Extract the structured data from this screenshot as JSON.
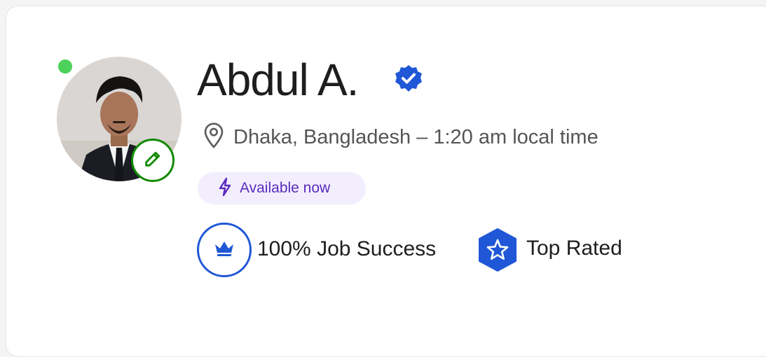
{
  "profile": {
    "name": "Abdul A.",
    "location": "Dhaka, Bangladesh – 1:20 am local time",
    "availability": "Available now",
    "online": true,
    "verified": true
  },
  "badges": {
    "job_success": "100% Job Success",
    "top_rated": "Top Rated"
  },
  "icons": {
    "verified": "verified-badge-icon",
    "location": "location-pin-icon",
    "availability": "lightning-bolt-icon",
    "edit": "pencil-icon",
    "job_success": "crown-icon",
    "top_rated": "star-icon"
  },
  "colors": {
    "online": "#4cd15a",
    "edit_accent": "#108a00",
    "verified": "#1f57d6",
    "availability_bg": "#f3eefe",
    "availability_text": "#5a2bbf",
    "badge_blue": "#1f57d6"
  }
}
